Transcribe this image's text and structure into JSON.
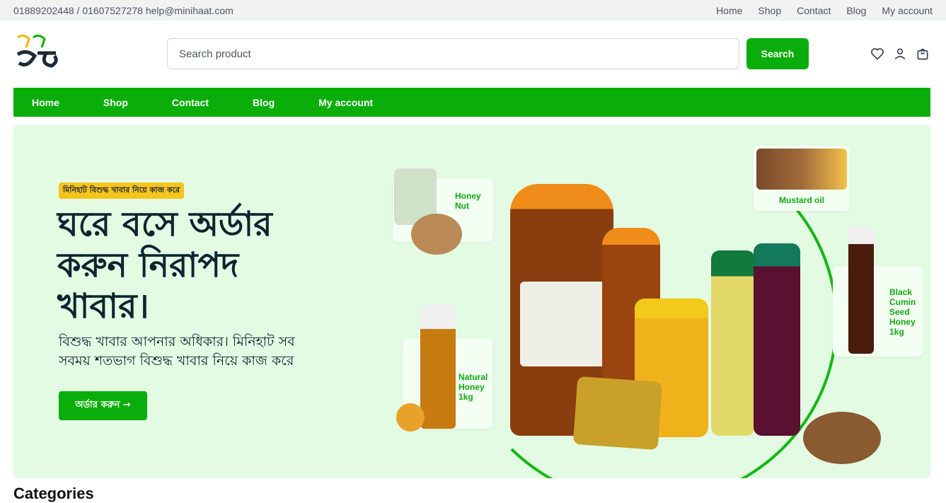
{
  "topbar": {
    "contact": "01889202448 / 01607527278 help@minihaat.com",
    "links": [
      "Home",
      "Shop",
      "Contact",
      "Blog",
      "My account"
    ]
  },
  "search": {
    "placeholder": "Search product",
    "button": "Search"
  },
  "icons": {
    "wishlist": "heart-icon",
    "account": "user-icon",
    "cart": "bag-icon"
  },
  "nav": {
    "items": [
      "Home",
      "Shop",
      "Contact",
      "Blog",
      "My account"
    ]
  },
  "hero": {
    "badge": "মিনিহাট বিশুদ্ধ খাবার নিয়ে কাজ করে",
    "title": "ঘরে বসে অর্ডার করুন নিরাপদ খাবার।",
    "subtitle": "বিশুদ্ধ খাবার আপনার অধিকার। মিনিহাট সব সবময় শতভাগ বিশুদ্ধ খাবার নিয়ে কাজ করে",
    "cta": "অর্ডার করুন →",
    "products": {
      "honey_nut": "Honey Nut",
      "mustard_oil": "Mustard oil",
      "natural_honey": "Natural Honey 1kg",
      "black_cumin": "Black Cumin Seed Honey 1kg"
    }
  },
  "colors": {
    "brand": "#0aae0a",
    "hero_bg": "#e3fbe3",
    "badge": "#f7c51c"
  },
  "categories": {
    "heading": "Categories"
  }
}
